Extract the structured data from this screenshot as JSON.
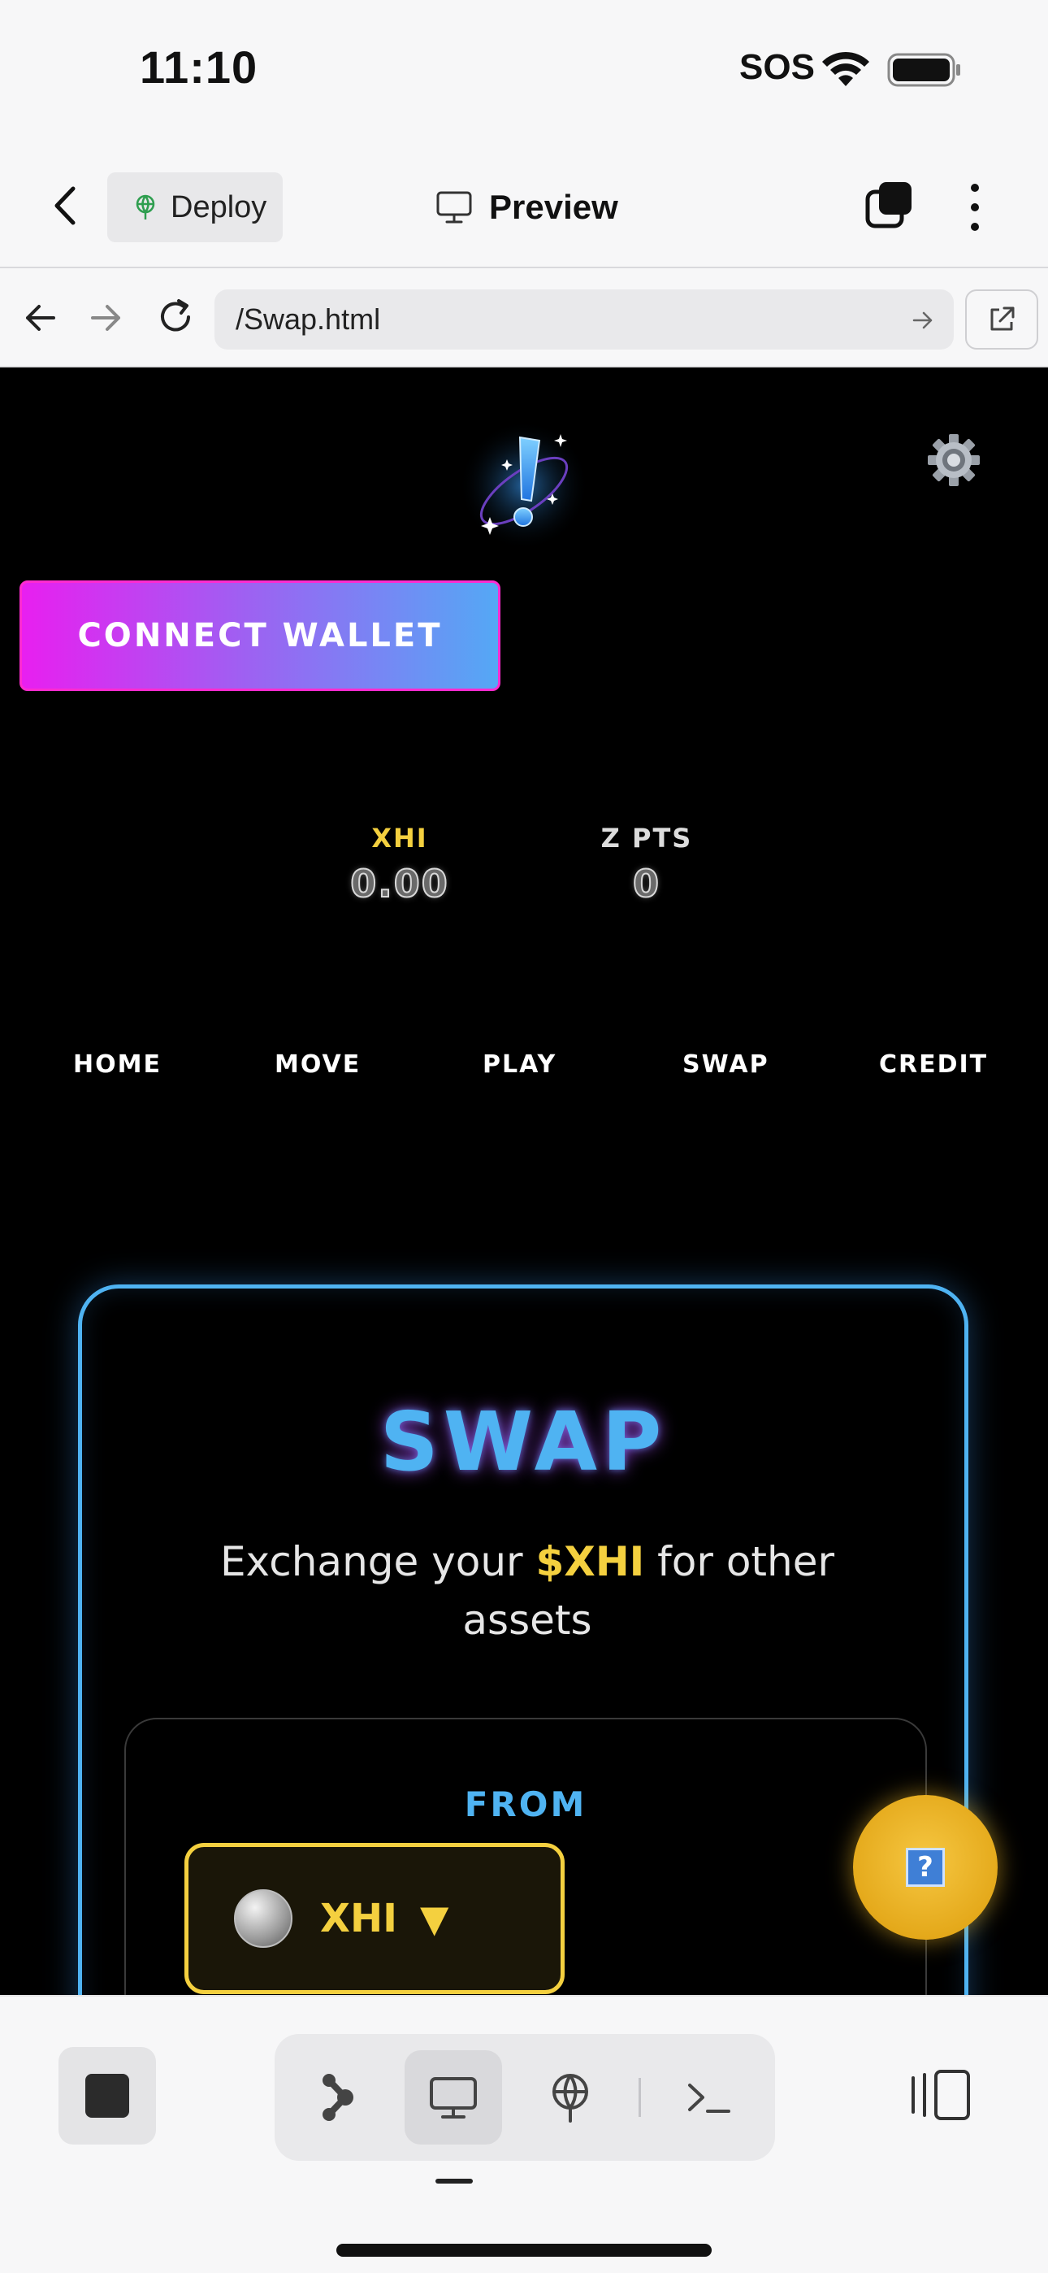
{
  "status_bar": {
    "time": "11:10",
    "sos": "SOS"
  },
  "app_bar": {
    "deploy_label": "Deploy",
    "title": "Preview"
  },
  "browser": {
    "url": "/Swap.html"
  },
  "site": {
    "connect_wallet": "CONNECT WALLET",
    "stats": [
      {
        "label": "XHI",
        "value": "0.00"
      },
      {
        "label": "Z PTS",
        "value": "0"
      }
    ],
    "menu": [
      "HOME",
      "MOVE",
      "PLAY",
      "SWAP",
      "CREDIT"
    ],
    "swap": {
      "title": "SWAP",
      "subtitle_before": "Exchange your ",
      "subtitle_accent": "$XHI",
      "subtitle_after": " for other assets",
      "from_label": "FROM",
      "token": "XHI",
      "caret": "▼"
    },
    "help_glyph": "?"
  },
  "colors": {
    "accent_blue": "#4fb3f2",
    "accent_yellow": "#f4d03f",
    "accent_magenta": "#e81ff0"
  }
}
